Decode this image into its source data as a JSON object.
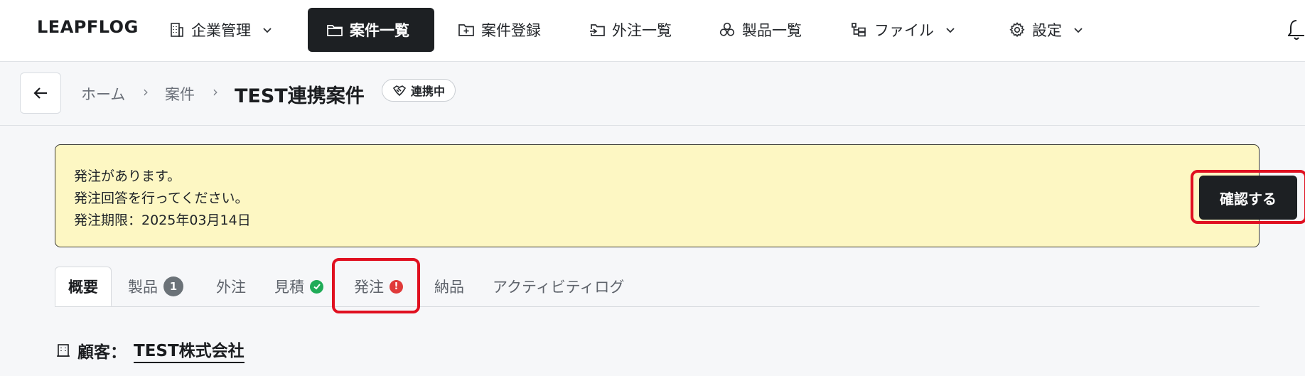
{
  "app": {
    "logo": "LEAPFLOG"
  },
  "nav": {
    "items": [
      {
        "label": "企業管理",
        "icon": "building-icon",
        "has_dropdown": true
      },
      {
        "label": "案件一覧",
        "icon": "folder-icon",
        "active": true
      },
      {
        "label": "案件登録",
        "icon": "folder-plus-icon"
      },
      {
        "label": "外注一覧",
        "icon": "folder-arrow-icon"
      },
      {
        "label": "製品一覧",
        "icon": "boxes-icon"
      },
      {
        "label": "ファイル",
        "icon": "file-tree-icon",
        "has_dropdown": true
      },
      {
        "label": "設定",
        "icon": "gear-icon",
        "has_dropdown": true
      }
    ]
  },
  "breadcrumb": {
    "items": [
      "ホーム",
      "案件"
    ],
    "current": "TEST連携案件",
    "status": "連携中"
  },
  "alert": {
    "lines": [
      "発注があります。",
      "発注回答を行ってください。",
      "発注期限：2025年03月14日"
    ],
    "button": "確認する"
  },
  "tabs": [
    {
      "label": "概要",
      "active": true
    },
    {
      "label": "製品",
      "count": "1"
    },
    {
      "label": "外注"
    },
    {
      "label": "見積",
      "status": "check"
    },
    {
      "label": "発注",
      "status": "alert",
      "alert_mark": "!"
    },
    {
      "label": "納品"
    },
    {
      "label": "アクティビティログ"
    }
  ],
  "customer": {
    "label": "顧客：",
    "name": "TEST株式会社"
  },
  "colors": {
    "primary_dark": "#1d2023",
    "alert_bg": "#fdf7c3",
    "highlight_red": "#e01020",
    "success_green": "#1fab57",
    "badge_gray": "#6b7278"
  }
}
